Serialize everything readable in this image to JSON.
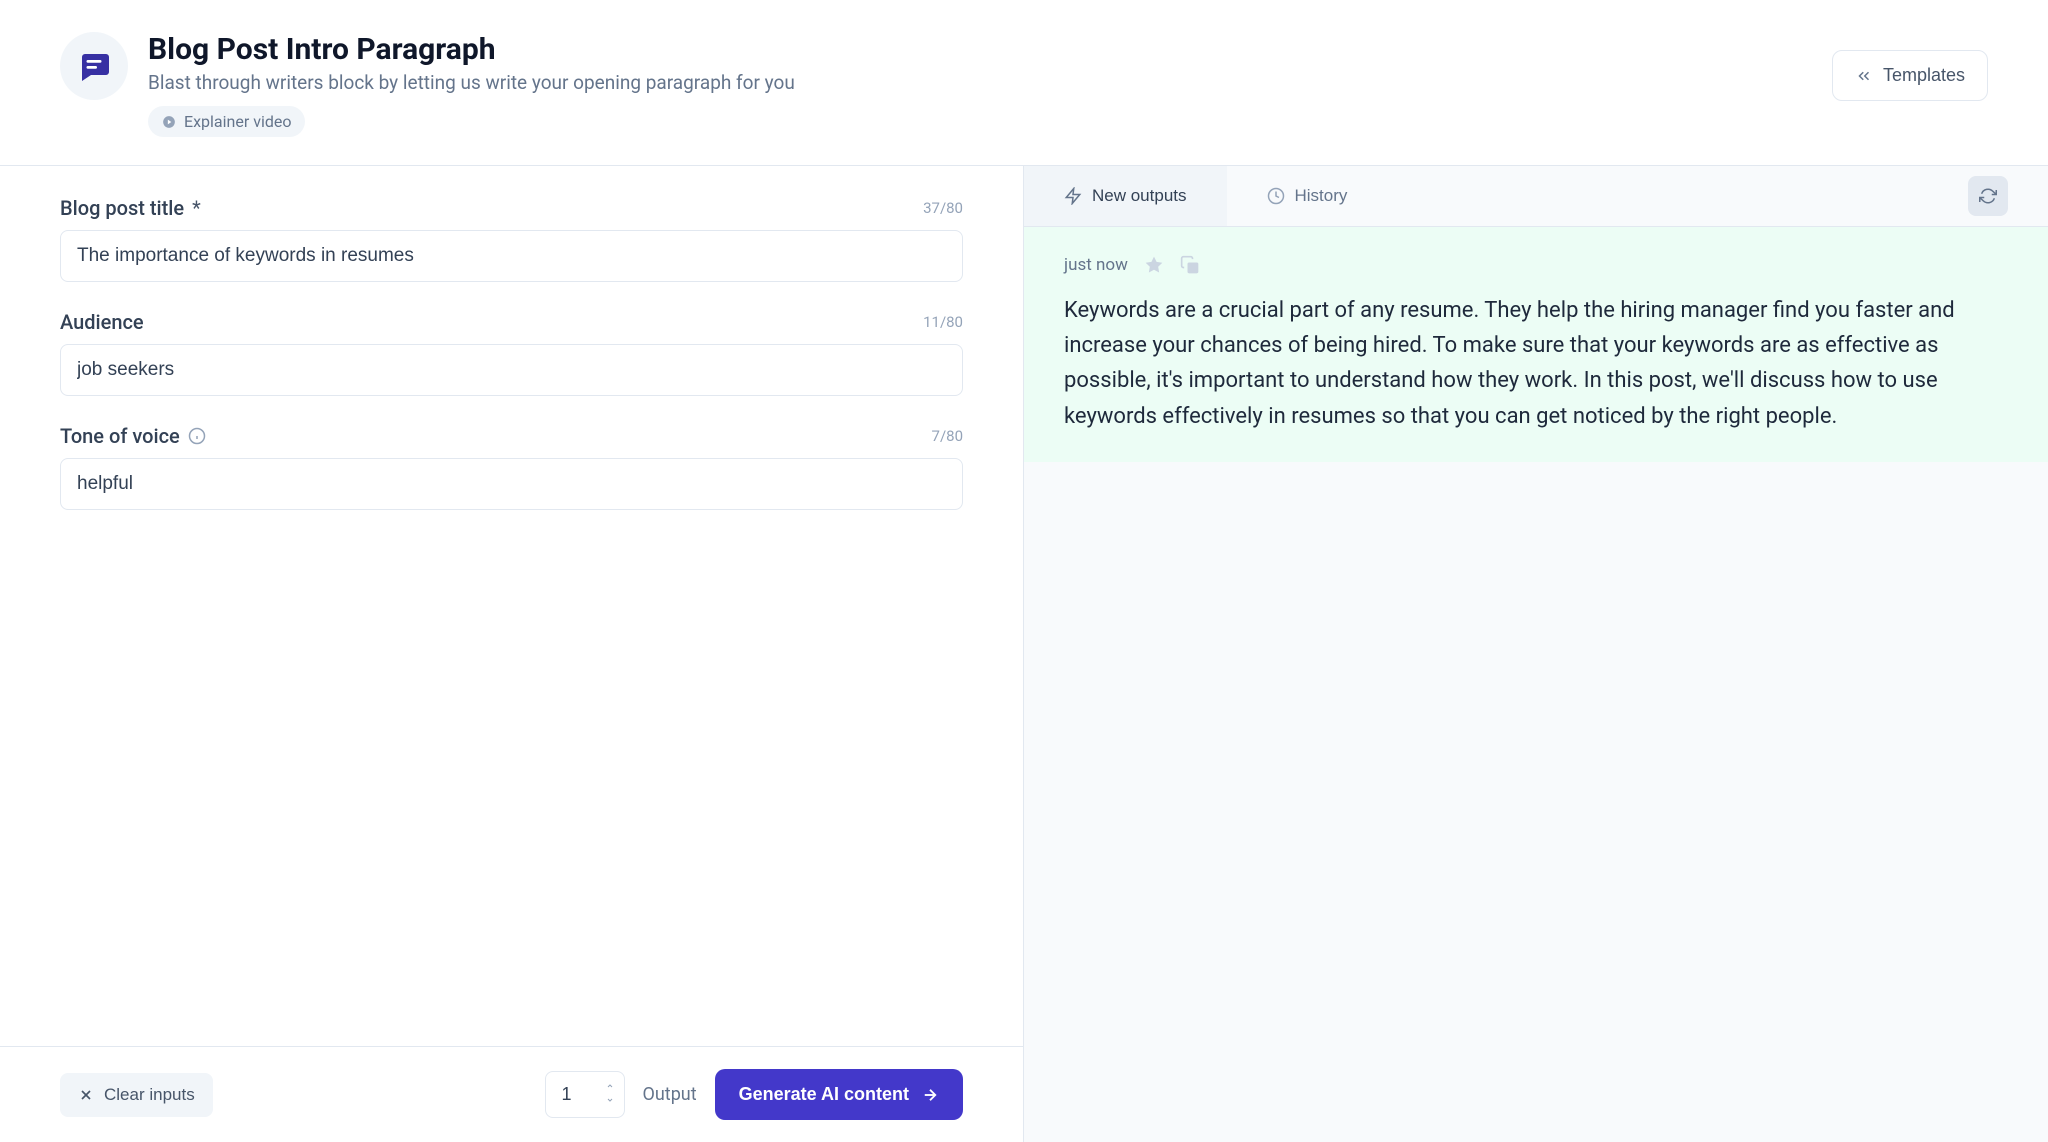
{
  "header": {
    "title": "Blog Post Intro Paragraph",
    "subtitle": "Blast through writers block by letting us write your opening paragraph for you",
    "explainer_label": "Explainer video",
    "templates_label": "Templates"
  },
  "form": {
    "title": {
      "label": "Blog post title",
      "value": "The importance of keywords in resumes",
      "count": "37/80"
    },
    "audience": {
      "label": "Audience",
      "value": "job seekers",
      "count": "11/80"
    },
    "tone": {
      "label": "Tone of voice",
      "value": "helpful",
      "count": "7/80"
    }
  },
  "bottom": {
    "clear_label": "Clear inputs",
    "output_count": "1",
    "output_label": "Output",
    "generate_label": "Generate AI content"
  },
  "tabs": {
    "new_outputs": "New outputs",
    "history": "History"
  },
  "output": {
    "timestamp": "just now",
    "text": "Keywords are a crucial part of any resume. They help the hiring manager find you faster and increase your chances of being hired. To make sure that your keywords are as effective as possible, it's important to understand how they work. In this post, we'll discuss how to use keywords effectively in resumes so that you can get noticed by the right people."
  }
}
